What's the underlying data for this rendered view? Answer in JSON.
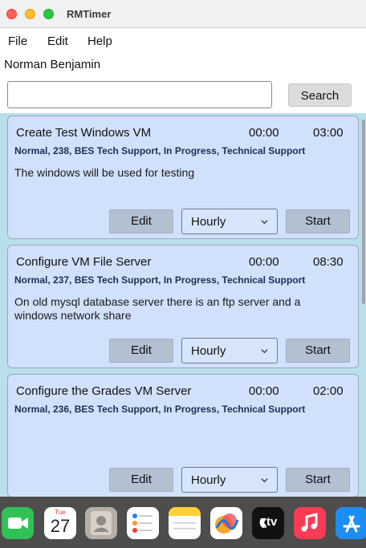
{
  "window": {
    "title": "RMTimer"
  },
  "menu": {
    "file": "File",
    "edit": "Edit",
    "help": "Help"
  },
  "user": {
    "name": "Norman Benjamin"
  },
  "search": {
    "value": "",
    "placeholder": "",
    "button": "Search"
  },
  "tasks": [
    {
      "title": "Create Test Windows VM",
      "elapsed": "00:00",
      "total": "03:00",
      "meta": "Normal, 238, BES Tech Support, In Progress, Technical Support",
      "description": "The windows will be used for testing",
      "edit_label": "Edit",
      "interval": "Hourly",
      "start_label": "Start"
    },
    {
      "title": "Configure VM File Server",
      "elapsed": "00:00",
      "total": "08:30",
      "meta": "Normal, 237, BES Tech Support, In Progress, Technical Support",
      "description": "On old mysql database server there is an ftp server and a windows network share",
      "edit_label": "Edit",
      "interval": "Hourly",
      "start_label": "Start"
    },
    {
      "title": "Configure the Grades VM Server",
      "elapsed": "00:00",
      "total": "02:00",
      "meta": "Normal, 236, BES Tech Support, In Progress, Technical Support",
      "description": "",
      "edit_label": "Edit",
      "interval": "Hourly",
      "start_label": "Start"
    }
  ],
  "dock": {
    "calendar_month": "Tue",
    "calendar_day": "27",
    "items": [
      "facetime-icon",
      "calendar-icon",
      "contacts-icon",
      "reminders-icon",
      "notes-icon",
      "freeform-icon",
      "apple-tv-icon",
      "music-icon",
      "app-store-icon"
    ],
    "tv_label": "tv"
  },
  "colors": {
    "card_bg": "#d1e1fb",
    "list_bg": "#b9e0ea",
    "button_bg": "#b2c0d2",
    "dock_bg": "#4d4d4d"
  }
}
